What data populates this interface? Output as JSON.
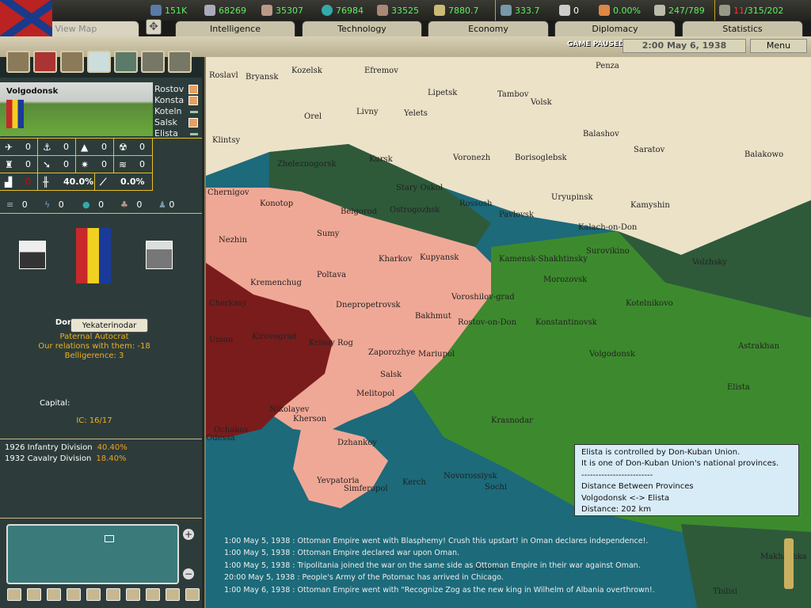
{
  "topbar": {
    "energy": "151K",
    "metal": "68269",
    "rare": "35307",
    "oil": "76984",
    "supplies": "33525",
    "money": "7880.7",
    "manpower": "333.7",
    "nukes": "0",
    "dissent": "0.00%",
    "transports": "247/789",
    "divisions_a": "11",
    "divisions_b": "/315/202"
  },
  "tabs": [
    "View Map",
    "Intelligence",
    "Technology",
    "Economy",
    "Diplomacy",
    "Statistics"
  ],
  "status": {
    "paused": "GAME PAUSED",
    "date": "2:00 May 6, 1938",
    "menu": "Menu"
  },
  "province": {
    "name": "Volgodonsk",
    "neighbors": [
      "Rostov",
      "Konsta",
      "Koteln",
      "Salsk",
      "Elista"
    ],
    "stats": [
      "0",
      "0",
      "0",
      "0",
      "0",
      "0",
      "0",
      "0",
      "0",
      "40.0%",
      "0.0%"
    ],
    "resources": [
      "0",
      "0",
      "0",
      "0",
      "0"
    ]
  },
  "country": {
    "name": "Don-Kuban Union",
    "ideology": "Paternal Autocrat",
    "relations": "Our relations with them: -18",
    "belligerence": "Belligerence: 3",
    "capital_label": "Capital:",
    "capital": "Yekaterinodar",
    "ic": "IC: 16/17"
  },
  "units": [
    {
      "name": "1926 Infantry Division",
      "pct": "40.40%"
    },
    {
      "name": "1932 Cavalry Division",
      "pct": "18.40%"
    }
  ],
  "map_labels": [
    "Roslavl",
    "Bryansk",
    "Kozelsk",
    "Efremov",
    "Penza",
    "Tambov",
    "Orel",
    "Livny",
    "Yelets",
    "Volsk",
    "Lipetsk",
    "Klintsy",
    "Kursk",
    "Voronezh",
    "Borisoglebsk",
    "Balashov",
    "Saratov",
    "Balakowo",
    "Zheleznogorsk",
    "Stary Oskol",
    "Chernigov",
    "Konotop",
    "Belgorod",
    "Ostrogozhsk",
    "Rossosh",
    "Pavlovsk",
    "Uryupinsk",
    "Kamyshin",
    "Kalach-on-Don",
    "Nezhin",
    "Sumy",
    "Kharkov",
    "Kupyansk",
    "Kamensk-Shakhtinsky",
    "Surovikino",
    "Volzhsky",
    "Kremenchug",
    "Poltava",
    "Morozovsk",
    "Cherkasy",
    "Dnepropetrovsk",
    "Voroshilov-grad",
    "Bakhmut",
    "Rostov-on-Don",
    "Konstantinovsk",
    "Kotelnikovo",
    "Kirovograd",
    "Krivoy Rog",
    "Zaporozhye",
    "Mariupol",
    "Volgodonsk",
    "Astrakhan",
    "Nikolayev",
    "Melitopol",
    "Salsk",
    "Elista",
    "Ochakov",
    "Kherson",
    "Krasnodar",
    "Odessa",
    "Dzhankoy",
    "Kerch",
    "Novorossiysk",
    "Yevpatoria",
    "Simferopol",
    "Sochi",
    "Tbilisi",
    "Makhachka",
    "Kutaisi",
    "Uman"
  ],
  "tooltip": [
    "Elista is controlled by Don-Kuban Union.",
    "It is one of Don-Kuban Union's national provinces.",
    "-------------------------",
    "Distance Between Provinces",
    "Volgodonsk <-> Elista",
    "Distance: 202 km"
  ],
  "log": [
    "1:00 May 5, 1938 : Ottoman Empire went with Blasphemy! Crush this upstart! in Oman declares independence!.",
    "1:00 May 5, 1938 : Ottoman Empire declared war upon Oman.",
    "1:00 May 5, 1938 : Tripolitania joined the war on the same side as Ottoman Empire in their war against Oman.",
    "20:00 May 5, 1938 : People's Army of the Potomac has arrived in Chicago.",
    "1:00 May 6, 1938 : Ottoman Empire went with \"Recognize Zog as the new king in Wilhelm of Albania overthrown!."
  ]
}
